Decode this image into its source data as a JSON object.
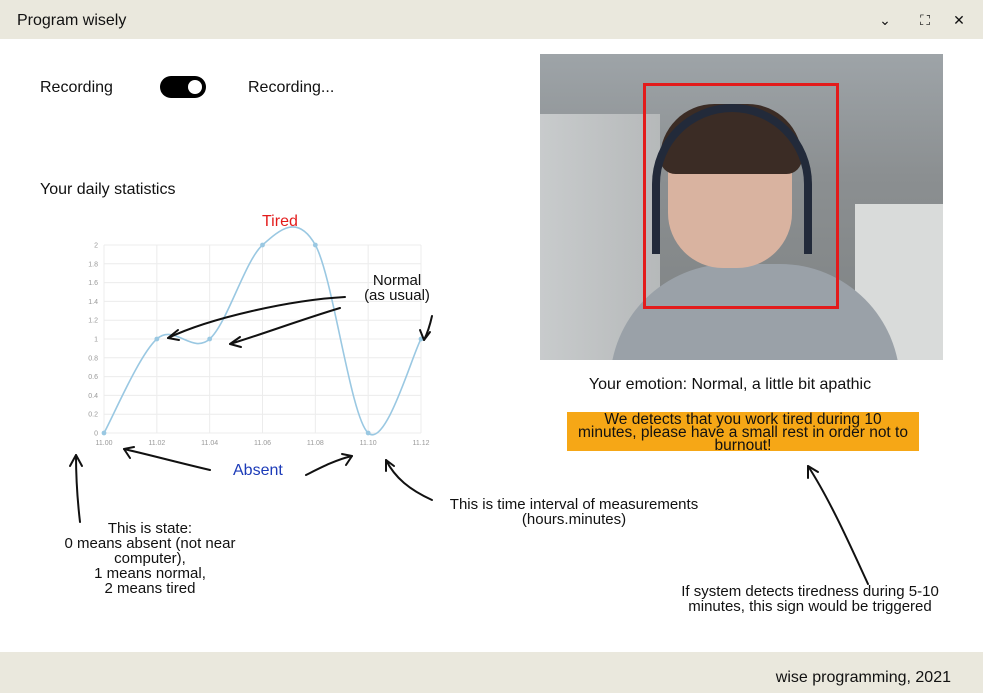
{
  "window": {
    "title": "Program wisely",
    "controls": [
      {
        "name": "chevron-down-icon",
        "glyph": "⌄"
      },
      {
        "name": "fullscreen-icon",
        "glyph": "⛶"
      },
      {
        "name": "close-icon",
        "glyph": "✕"
      }
    ]
  },
  "recording": {
    "label": "Recording",
    "status": "Recording...",
    "enabled": true
  },
  "stats": {
    "heading": "Your daily statistics"
  },
  "chart_data": {
    "type": "line",
    "x": [
      "11.00",
      "11.02",
      "11.04",
      "11.06",
      "11.08",
      "11.10",
      "11.12"
    ],
    "values": [
      0,
      1,
      1,
      2,
      2,
      0,
      1
    ],
    "yticks": [
      "0",
      "0.2",
      "0.4",
      "0.6",
      "0.8",
      "1",
      "1.2",
      "1.4",
      "1.6",
      "1.8",
      "2"
    ],
    "ylim": [
      0,
      2
    ],
    "grid": true,
    "line_color": "#9ac8e2"
  },
  "annotations": {
    "tired": "Tired",
    "normal_line1": "Normal",
    "normal_line2": "(as usual)",
    "absent": "Absent",
    "state_lines": [
      "This is state:",
      "0 means absent (not near",
      "computer),",
      "1 means normal,",
      "2 means tired"
    ],
    "time_lines": [
      "This is time interval of measurements",
      "(hours.minutes)"
    ],
    "trigger_lines": [
      "If system detects tiredness during 5-10",
      "minutes, this sign would be triggered"
    ]
  },
  "emotion": "Your emotion: Normal, a little bit apathic",
  "warning_lines": [
    "We detects that you work tired during 10",
    "minutes, please have a small rest in order not to",
    "burnout!"
  ],
  "footer": "wise programming, 2021",
  "colors": {
    "tired": "#e31b1b",
    "absent": "#1c3bb8",
    "warning_bg": "#f6a716",
    "chrome": "#eae8dd"
  }
}
